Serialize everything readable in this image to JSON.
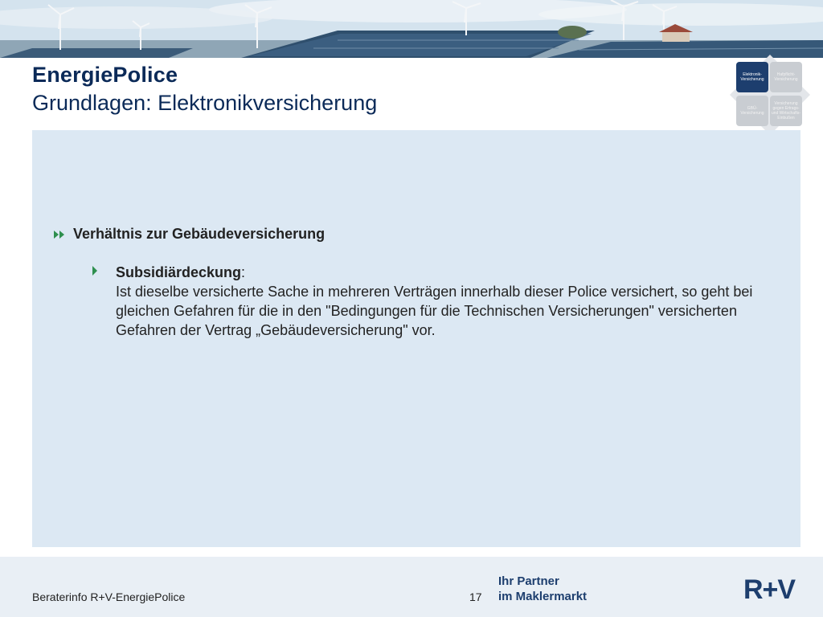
{
  "header": {
    "title": "EnergiePolice",
    "subtitle": "Grundlagen: Elektronikversicherung"
  },
  "nav_diagram": {
    "cells": [
      {
        "label": "Elektronik-Versicherung",
        "active": true
      },
      {
        "label": "Hafpflicht-Versicherung",
        "active": false
      },
      {
        "label": "GBÜ-Versicherung",
        "active": false
      },
      {
        "label": "Versicherung gegen Ertrags- und Wirtschafts-Einbußen",
        "active": false
      }
    ]
  },
  "content": {
    "bullet_heading": "Verhältnis zur Gebäudeversicherung",
    "sub_bullet": {
      "title": "Subsidiärdeckung",
      "title_suffix": ":",
      "body": "Ist dieselbe versicherte Sache in mehreren Verträgen innerhalb dieser Police versichert, so geht bei gleichen Gefahren für die in den \"Bedingungen für die Technischen Versicherungen\" versicherten Gefahren der Vertrag „Gebäudeversicherung\" vor."
    }
  },
  "footer": {
    "left_text": "Beraterinfo R+V-EnergiePolice",
    "page_number": "17",
    "tagline_line1": "Ihr Partner",
    "tagline_line2": "im Maklermarkt",
    "logo_text": "R+V"
  },
  "colors": {
    "title": "#0b2a58",
    "panel": "#dce8f3",
    "accent": "#1d3e6e"
  }
}
